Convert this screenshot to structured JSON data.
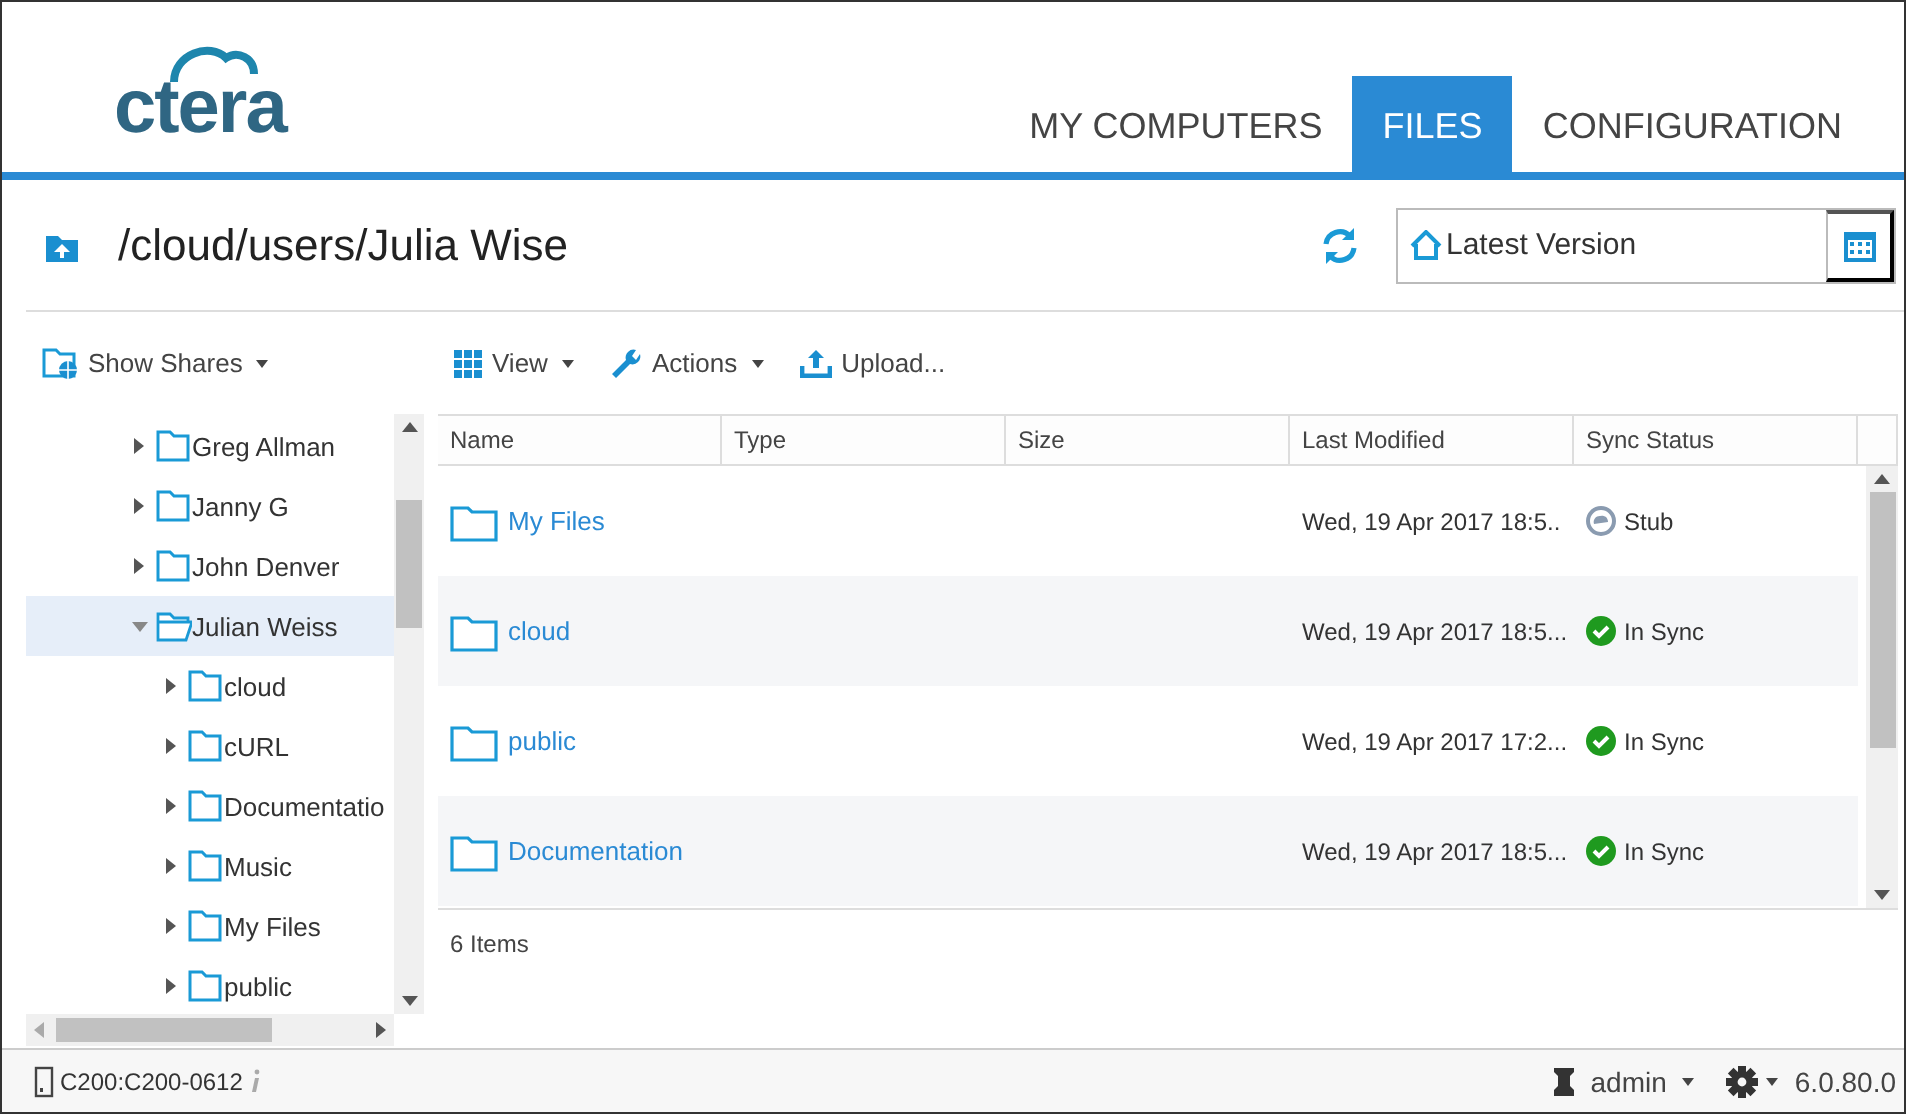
{
  "logo": {
    "text": "ctera"
  },
  "tabs": [
    {
      "label": "MY COMPUTERS",
      "selected": false
    },
    {
      "label": "FILES",
      "selected": true
    },
    {
      "label": "CONFIGURATION",
      "selected": false
    }
  ],
  "path": {
    "title": "/cloud/users/Julia Wise"
  },
  "version": {
    "value": "Latest Version"
  },
  "toolbar": {
    "show_shares": "Show Shares",
    "view": "View",
    "actions": "Actions",
    "upload": "Upload..."
  },
  "tree": [
    {
      "label": "Greg Allman",
      "expanded": false,
      "selected": false
    },
    {
      "label": "Janny G",
      "expanded": false,
      "selected": false
    },
    {
      "label": "John Denver",
      "expanded": false,
      "selected": false
    },
    {
      "label": "Julian Weiss",
      "expanded": true,
      "selected": true,
      "children": [
        {
          "label": "cloud",
          "expanded": false,
          "selected": false
        },
        {
          "label": "cURL",
          "expanded": false,
          "selected": false
        },
        {
          "label": "Documentatio",
          "expanded": false,
          "selected": false
        },
        {
          "label": "Music",
          "expanded": false,
          "selected": false
        },
        {
          "label": "My Files",
          "expanded": false,
          "selected": false
        },
        {
          "label": "public",
          "expanded": false,
          "selected": false
        }
      ]
    }
  ],
  "table": {
    "columns": [
      "Name",
      "Type",
      "Size",
      "Last Modified",
      "Sync Status"
    ],
    "rows": [
      {
        "name": "My Files",
        "modified": "Wed, 19 Apr 2017 18:5..",
        "status": "Stub",
        "kind": "stub"
      },
      {
        "name": "cloud",
        "modified": "Wed, 19 Apr 2017 18:5...",
        "status": "In Sync",
        "kind": "in_sync"
      },
      {
        "name": "public",
        "modified": "Wed, 19 Apr 2017 17:2...",
        "status": "In Sync",
        "kind": "in_sync"
      },
      {
        "name": "Documentation",
        "modified": "Wed, 19 Apr 2017 18:5...",
        "status": "In Sync",
        "kind": "in_sync"
      }
    ],
    "count": "6 Items"
  },
  "status_bar": {
    "device": "C200:C200-0612",
    "user": "admin",
    "version": "6.0.80.0"
  }
}
